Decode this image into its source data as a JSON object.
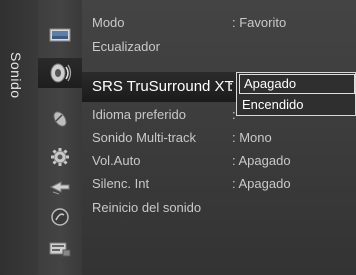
{
  "section": {
    "label": "Sonido"
  },
  "icons": [
    {
      "name": "picture-icon"
    },
    {
      "name": "sound-icon",
      "active": true
    },
    {
      "name": "channel-icon"
    },
    {
      "name": "setup-icon"
    },
    {
      "name": "input-icon"
    },
    {
      "name": "support-icon"
    },
    {
      "name": "application-icon"
    }
  ],
  "menu": {
    "items": [
      {
        "label": "Modo",
        "value": ": Favorito"
      },
      {
        "label": "Ecualizador",
        "value": ""
      },
      {
        "label": "SRS TruSurround XT",
        "value": ":"
      },
      {
        "label": "Idioma preferido",
        "value": ":"
      },
      {
        "label": "Sonido Multi-track",
        "value": ": Mono"
      },
      {
        "label": "Vol.Auto",
        "value": ": Apagado"
      },
      {
        "label": "Silenc. Int",
        "value": ": Apagado"
      },
      {
        "label": "Reinicio del sonido",
        "value": ""
      }
    ],
    "selected_index": 2
  },
  "dropdown": {
    "options": [
      "Apagado",
      "Encendido"
    ],
    "selected": "Apagado"
  }
}
